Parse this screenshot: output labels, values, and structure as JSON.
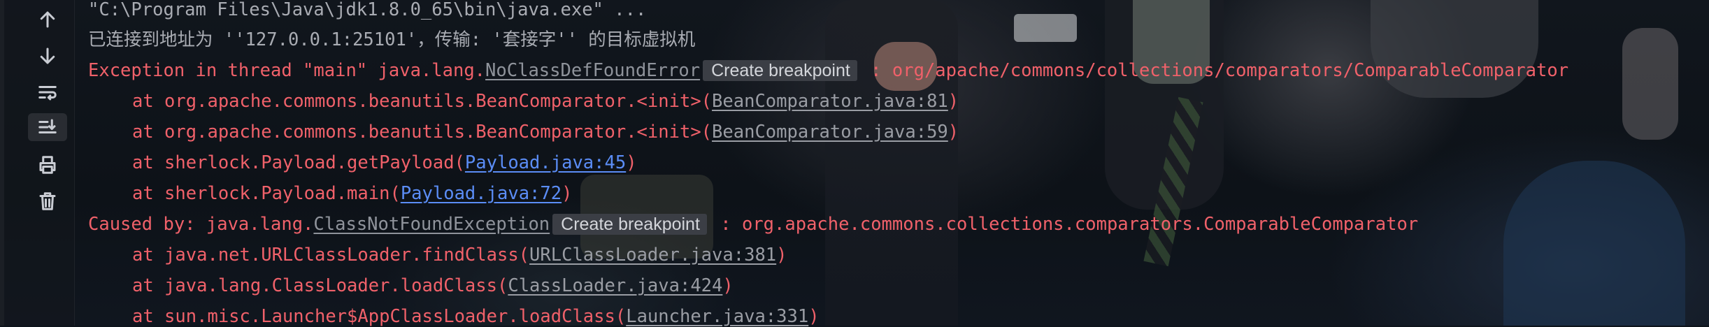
{
  "colors": {
    "error_text": "#f0616a",
    "normal_text": "#a9acb3",
    "file_link": "#5b8df6",
    "library_link": "#9a9da4",
    "breakpoint_badge_bg": "#3b3e45"
  },
  "toolbar": [
    {
      "name": "up-arrow-icon",
      "tooltip": "Up"
    },
    {
      "name": "down-arrow-icon",
      "tooltip": "Down"
    },
    {
      "name": "soft-wrap-icon",
      "tooltip": "Soft-Wrap"
    },
    {
      "name": "scroll-to-end-icon",
      "tooltip": "Scroll to the End",
      "active": true
    },
    {
      "name": "print-icon",
      "tooltip": "Print"
    },
    {
      "name": "trash-icon",
      "tooltip": "Clear All"
    }
  ],
  "console": {
    "cmd": "\"C:\\Program Files\\Java\\jdk1.8.0_65\\bin\\java.exe\" ...",
    "connected": "已连接到地址为 ''127.0.0.1:25101'，传输: '套接字'' 的目标虚拟机",
    "exception": {
      "prefix": "Exception in thread \"main\" java.lang.",
      "class": "NoClassDefFoundError",
      "badge": "Create breakpoint",
      "suffix": " : org/apache/commons/collections/comparators/ComparableComparator"
    },
    "stack1": [
      {
        "prefix": "at org.apache.commons.beanutils.BeanComparator.<init>(",
        "link": "BeanComparator.java:81",
        "suffix": ")",
        "kind": "library"
      },
      {
        "prefix": "at org.apache.commons.beanutils.BeanComparator.<init>(",
        "link": "BeanComparator.java:59",
        "suffix": ")",
        "kind": "library"
      },
      {
        "prefix": "at sherlock.Payload.getPayload(",
        "link": "Payload.java:45",
        "suffix": ")",
        "kind": "project"
      },
      {
        "prefix": "at sherlock.Payload.main(",
        "link": "Payload.java:72",
        "suffix": ")",
        "kind": "project"
      }
    ],
    "caused": {
      "prefix": "Caused by: java.lang.",
      "class": "ClassNotFoundException",
      "badge": "Create breakpoint",
      "suffix": " : org.apache.commons.collections.comparators.ComparableComparator"
    },
    "stack2": [
      {
        "prefix": "at java.net.URLClassLoader.findClass(",
        "link": "URLClassLoader.java:381",
        "suffix": ")",
        "kind": "library"
      },
      {
        "prefix": "at java.lang.ClassLoader.loadClass(",
        "link": "ClassLoader.java:424",
        "suffix": ")",
        "kind": "library"
      },
      {
        "prefix": "at sun.misc.Launcher$AppClassLoader.loadClass(",
        "link": "Launcher.java:331",
        "suffix": ")",
        "kind": "library"
      }
    ]
  }
}
